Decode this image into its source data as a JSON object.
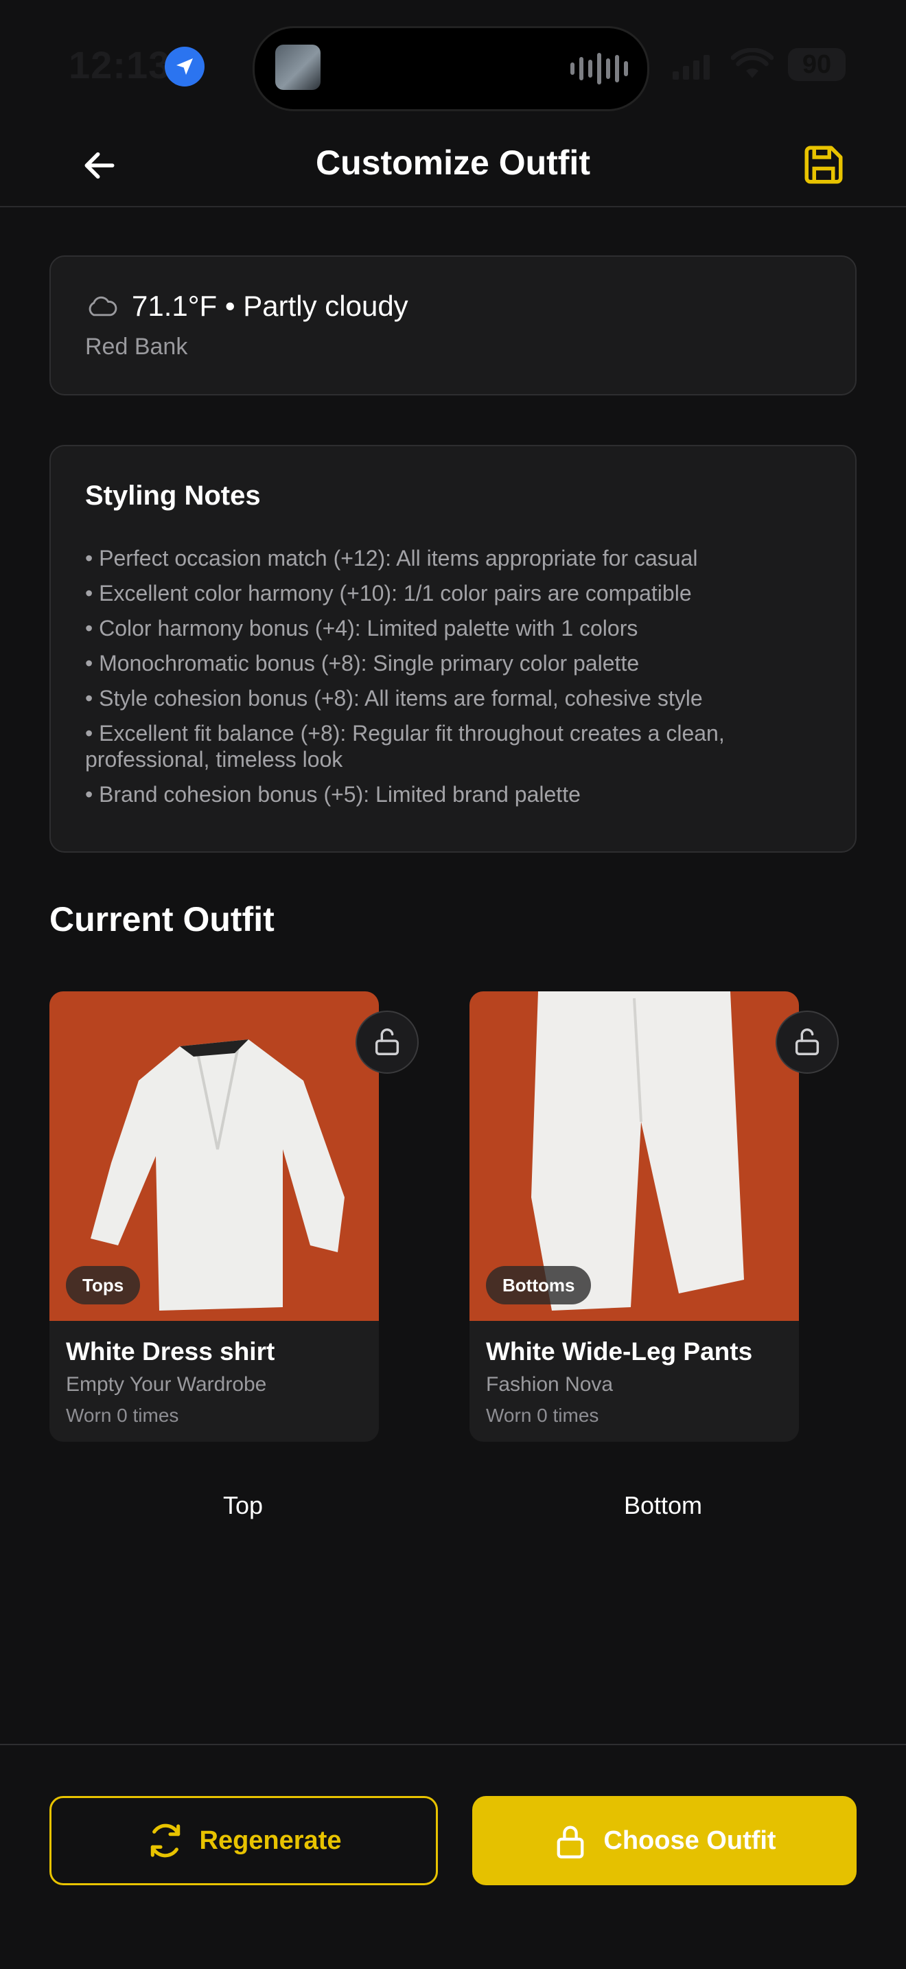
{
  "status_bar": {
    "time": "12:13",
    "battery": "90"
  },
  "header": {
    "title": "Customize Outfit"
  },
  "weather": {
    "summary": "71.1°F • Partly cloudy",
    "location": "Red Bank"
  },
  "styling_notes": {
    "title": "Styling Notes",
    "items": [
      "• Perfect occasion match (+12): All items appropriate for casual",
      "• Excellent color harmony (+10): 1/1 color pairs are compatible",
      "• Color harmony bonus (+4): Limited palette with 1 colors",
      "• Monochromatic bonus (+8): Single primary color palette",
      "• Style cohesion bonus (+8): All items are formal, cohesive style",
      "• Excellent fit balance (+8): Regular fit throughout creates a clean, professional, timeless look",
      "• Brand cohesion bonus (+5): Limited brand palette"
    ]
  },
  "current_outfit": {
    "title": "Current Outfit",
    "items": [
      {
        "category": "Tops",
        "name": "White Dress shirt",
        "brand": "Empty Your Wardrobe",
        "worn": "Worn 0 times",
        "slot": "Top"
      },
      {
        "category": "Bottoms",
        "name": "White Wide-Leg Pants",
        "brand": "Fashion Nova",
        "worn": "Worn 0 times",
        "slot": "Bottom"
      }
    ]
  },
  "actions": {
    "regenerate": "Regenerate",
    "choose": "Choose Outfit"
  },
  "colors": {
    "background": "#111112",
    "card": "#1b1b1c",
    "accent": "#e5c100",
    "photo_bg": "#b8441f",
    "location_blue": "#2b74f0"
  },
  "icons": [
    "location-arrow-icon",
    "back-arrow-icon",
    "save-icon",
    "cloud-icon",
    "unlock-icon",
    "refresh-icon",
    "lock-icon"
  ]
}
